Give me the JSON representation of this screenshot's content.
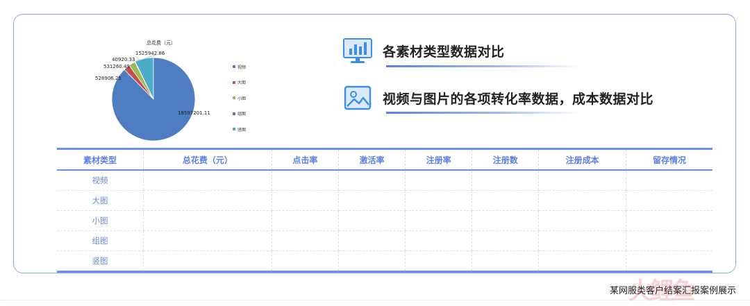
{
  "chart_data": {
    "type": "pie",
    "title": "总花费（元）",
    "series": [
      {
        "name": "视频",
        "value": 18597201.11,
        "color": "#4f7dc2"
      },
      {
        "name": "大图",
        "value": 528906.25,
        "color": "#c0504d"
      },
      {
        "name": "小图",
        "value": 531260.49,
        "color": "#9bbb59"
      },
      {
        "name": "组图",
        "value": 40920.33,
        "color": "#8064a2"
      },
      {
        "name": "竖图",
        "value": 1525942.86,
        "color": "#4bacc6"
      }
    ],
    "labels": [
      "18597201.11",
      "528906.25",
      "531260.49",
      "40920.33",
      "1525942.86"
    ],
    "legend_position": "right"
  },
  "features": {
    "item1": "各素材类型数据对比",
    "item2": "视频与图片的各项转化率数据，成本数据对比"
  },
  "icons": {
    "feature1": "bar-chart-monitor-icon",
    "feature2": "image-icon"
  },
  "table": {
    "headers": [
      "素材类型",
      "总花费（元）",
      "点击率",
      "激活率",
      "注册率",
      "注册数",
      "注册成本",
      "留存情况"
    ],
    "rows": [
      [
        "视频",
        "",
        "",
        "",
        "",
        "",
        "",
        ""
      ],
      [
        "大图",
        "",
        "",
        "",
        "",
        "",
        "",
        ""
      ],
      [
        "小图",
        "",
        "",
        "",
        "",
        "",
        "",
        ""
      ],
      [
        "组图",
        "",
        "",
        "",
        "",
        "",
        "",
        ""
      ],
      [
        "竖图",
        "",
        "",
        "",
        "",
        "",
        "",
        ""
      ]
    ]
  },
  "footer": {
    "caption": "某网服类客户结案汇报案例展示",
    "watermark": "火鲤鱼"
  },
  "colors": {
    "accent": "#6b8ee8",
    "text_blue": "#5b7fe3"
  }
}
